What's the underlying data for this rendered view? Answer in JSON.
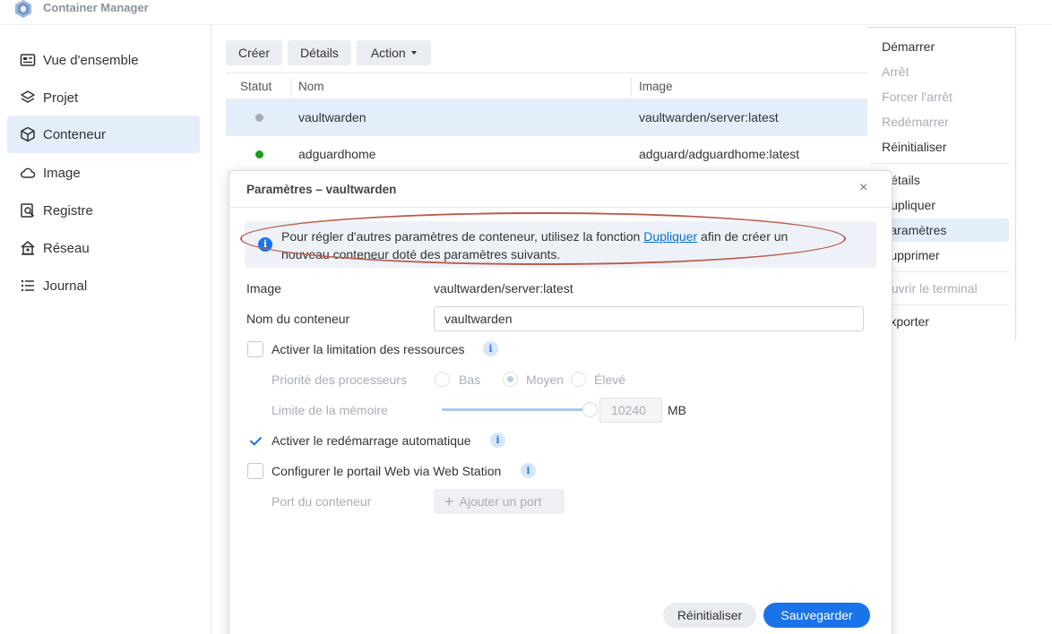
{
  "app": {
    "title": "Container Manager",
    "logo_icon": "container-manager-logo"
  },
  "sidebar": {
    "items": [
      {
        "label": "Vue d'ensemble",
        "icon": "overview-icon"
      },
      {
        "label": "Projet",
        "icon": "layers-icon"
      },
      {
        "label": "Conteneur",
        "icon": "cube-icon",
        "active": true
      },
      {
        "label": "Image",
        "icon": "cloud-icon"
      },
      {
        "label": "Registre",
        "icon": "registry-search-icon"
      },
      {
        "label": "Réseau",
        "icon": "network-home-icon"
      },
      {
        "label": "Journal",
        "icon": "list-icon"
      }
    ]
  },
  "toolbar": {
    "create": "Créer",
    "details": "Détails",
    "action": "Action"
  },
  "table": {
    "headers": {
      "status": "Statut",
      "name": "Nom",
      "image": "Image"
    },
    "rows": [
      {
        "status": "stopped",
        "status_color": "#a9adb3",
        "name": "vaultwarden",
        "image": "vaultwarden/server:latest",
        "selected": true
      },
      {
        "status": "running",
        "status_color": "#1aa01a",
        "name": "adguardhome",
        "image": "adguard/adguardhome:latest",
        "selected": false
      }
    ]
  },
  "context_menu": {
    "groups": [
      [
        {
          "label": "Démarrer",
          "enabled": true
        },
        {
          "label": "Arrêt",
          "enabled": false
        },
        {
          "label": "Forcer l'arrêt",
          "enabled": false
        },
        {
          "label": "Redémarrer",
          "enabled": false
        },
        {
          "label": "Réinitialiser",
          "enabled": true
        }
      ],
      [
        {
          "label": "Détails",
          "enabled": true
        },
        {
          "label": "Dupliquer",
          "enabled": true
        },
        {
          "label": "Paramètres",
          "enabled": true,
          "highlighted": true
        },
        {
          "label": "Supprimer",
          "enabled": true
        }
      ],
      [
        {
          "label": "Ouvrir le terminal",
          "enabled": false
        }
      ],
      [
        {
          "label": "Exporter",
          "enabled": true
        }
      ]
    ]
  },
  "dialog": {
    "title": "Paramètres – vaultwarden",
    "close_glyph": "×",
    "info": {
      "before": "Pour régler d'autres paramètres de conteneur, utilisez la fonction ",
      "link": "Dupliquer",
      "after": " afin de créer un nouveau conteneur doté des paramètres suivants."
    },
    "image_label": "Image",
    "image_value": "vaultwarden/server:latest",
    "name_label": "Nom du conteneur",
    "name_value": "vaultwarden",
    "resource_limit": {
      "label": "Activer la limitation des ressources",
      "checked": false
    },
    "cpu_priority": {
      "label": "Priorité des processeurs",
      "options": [
        "Bas",
        "Moyen",
        "Élevé"
      ],
      "selected": "Moyen"
    },
    "memory": {
      "label": "Limite de la mémoire",
      "value": "10240",
      "unit": "MB",
      "fraction": 1.0
    },
    "auto_restart": {
      "label": "Activer le redémarrage automatique",
      "checked": true
    },
    "web_portal": {
      "label": "Configurer le portail Web via Web Station",
      "checked": false
    },
    "port": {
      "label": "Port du conteneur",
      "button": "Ajouter un port"
    },
    "help_glyph": "i",
    "buttons": {
      "reset": "Réinitialiser",
      "save": "Sauvegarder"
    }
  }
}
